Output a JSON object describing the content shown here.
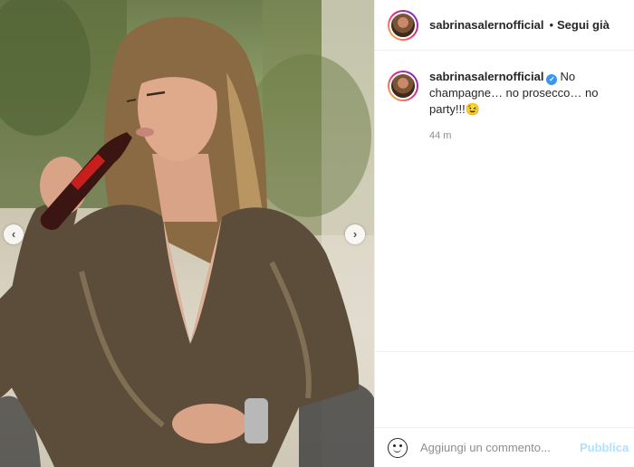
{
  "post": {
    "username": "sabrinasalernofficial",
    "follow_separator": "•",
    "follow_label": "Segui già",
    "caption_username": "sabrinasalernofficial",
    "caption_text": "No champagne… no prosecco… no party!!!😉",
    "timestamp": "44 m"
  },
  "photo": {
    "prev_arrow": "‹",
    "next_arrow": "›"
  },
  "comment": {
    "placeholder": "Aggiungi un commento...",
    "publish_label": "Pubblica"
  },
  "colors": {
    "accent": "#3897f0",
    "publish_disabled": "#b2dffc",
    "border": "#efefef"
  }
}
